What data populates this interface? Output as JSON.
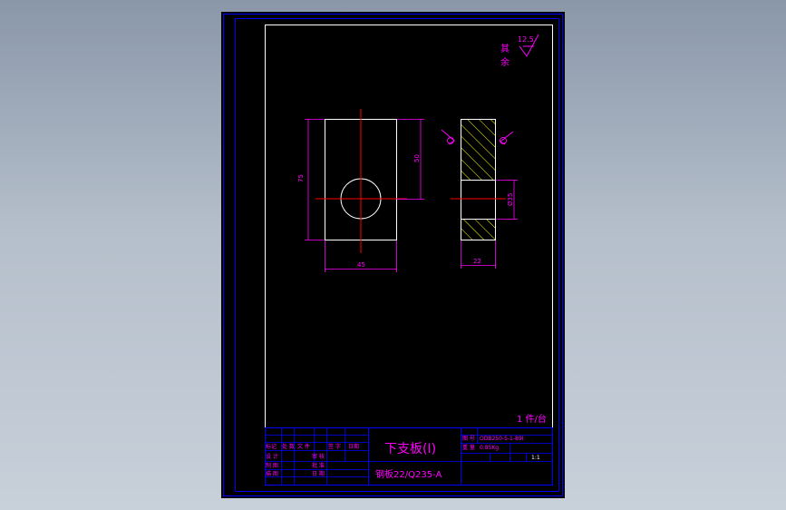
{
  "colors": {
    "background": "#000000",
    "frame": "#0000ff",
    "outline": "#ffffff",
    "centerline": "#ff0000",
    "dimension": "#ff00ff",
    "hatch": "#ffff00",
    "title_text": "#ff00ff"
  },
  "roughness": {
    "label": "其余",
    "value": "12.5"
  },
  "dimensions": {
    "height_total": "75",
    "hole_center": "50",
    "width": "45",
    "bore": "Ø35",
    "thickness": "22"
  },
  "title_block": {
    "part_name": "下支板(Ⅰ)",
    "material": "钢板22/Q235-A",
    "quantity": "1 件/台",
    "drawing_no_label": "图 号",
    "drawing_no": "ODB250-5-1-89Ⅰ",
    "weight_label": "重 量",
    "weight": "0.85Kg",
    "scale": "1:1",
    "rev_headers": [
      "标记",
      "处 数",
      "文 件",
      "签 字",
      "日期"
    ],
    "signoff_rows": [
      [
        "设 计",
        "审 核"
      ],
      [
        "制 图",
        "批 准"
      ],
      [
        "描 图",
        "日 期"
      ]
    ]
  }
}
